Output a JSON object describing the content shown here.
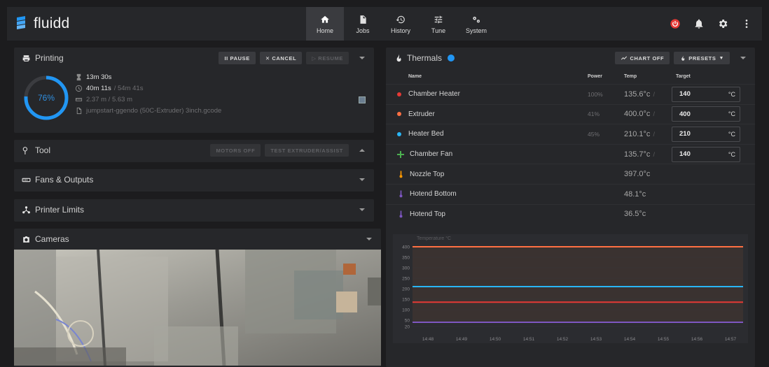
{
  "app": {
    "brand": "fluidd",
    "nav": [
      {
        "label": "Home",
        "icon": "home-icon",
        "active": true
      },
      {
        "label": "Jobs",
        "icon": "file-icon",
        "active": false
      },
      {
        "label": "History",
        "icon": "history-icon",
        "active": false
      },
      {
        "label": "Tune",
        "icon": "tune-icon",
        "active": false
      },
      {
        "label": "System",
        "icon": "gears-icon",
        "active": false
      }
    ],
    "right_icons": [
      "power-icon",
      "bell-icon",
      "settings-icon",
      "more-vert-icon"
    ],
    "accent": "#e53935"
  },
  "printing": {
    "title": "Printing",
    "pause_label": "II PAUSE",
    "cancel_label": "✕ CANCEL",
    "resume_label": "▷ RESUME",
    "progress": 0.76,
    "progress_text": "76%",
    "elapsed": "13m 30s",
    "remaining": "40m 11s",
    "remaining_muted": "/ 54m 41s",
    "filament": "2.37 m / 5.63 m",
    "filename": "jumpstart-ggendo (50C-Extruder) 3inch.gcode"
  },
  "panels": {
    "tool": {
      "title": "Tool",
      "btn1": "MOTORS OFF",
      "btn2": "TEST EXTRUDER/ASSIST"
    },
    "fans": {
      "title": "Fans & Outputs"
    },
    "limits": {
      "title": "Printer Limits"
    },
    "cameras": {
      "title": "Cameras"
    }
  },
  "thermals": {
    "title": "Thermals",
    "chart_off_label": "CHART OFF",
    "presets_label": "PRESETS",
    "headers": {
      "name": "Name",
      "power": "Power",
      "temp": "Temp",
      "target": "Target"
    },
    "rows": [
      {
        "name": "Chamber Heater",
        "color": "#e53935",
        "kind": "dot",
        "power": "100%",
        "temp": "135.6°c",
        "target": "140",
        "unit": "°C"
      },
      {
        "name": "Extruder",
        "color": "#ff7043",
        "kind": "dot",
        "power": "41%",
        "temp": "400.0°c",
        "target": "400",
        "unit": "°C"
      },
      {
        "name": "Heater Bed",
        "color": "#29b6f6",
        "kind": "dot",
        "power": "45%",
        "temp": "210.1°c",
        "target": "210",
        "unit": "°C"
      },
      {
        "name": "Chamber Fan",
        "color": "#4caf50",
        "kind": "fan",
        "power": "",
        "temp": "135.7°c",
        "target": "140",
        "unit": "°C"
      },
      {
        "name": "Nozzle Top",
        "color": "#ff9800",
        "kind": "therm",
        "power": "",
        "temp": "397.0°c",
        "target": "",
        "unit": ""
      },
      {
        "name": "Hotend Bottom",
        "color": "#7e57c2",
        "kind": "therm",
        "power": "",
        "temp": "48.1°c",
        "target": "",
        "unit": ""
      },
      {
        "name": "Hotend Top",
        "color": "#7e57c2",
        "kind": "therm",
        "power": "",
        "temp": "36.5°c",
        "target": "",
        "unit": ""
      }
    ]
  },
  "chart_data": {
    "type": "line",
    "title": "",
    "ylabel": "Temperature °C",
    "xlabel": "",
    "ylim": [
      0,
      420
    ],
    "yticks": [
      400,
      350,
      300,
      250,
      200,
      150,
      100,
      50,
      20
    ],
    "x": [
      "14:48",
      "14:49",
      "14:50",
      "14:51",
      "14:52",
      "14:53",
      "14:54",
      "14:55",
      "14:56",
      "14:57"
    ],
    "series": [
      {
        "color": "#ff7043",
        "values": [
          400,
          400,
          400,
          400,
          400,
          400,
          400,
          400,
          400,
          400
        ]
      },
      {
        "color": "#29b6f6",
        "values": [
          210,
          210,
          210,
          210,
          210,
          210,
          210,
          210,
          210,
          210
        ]
      },
      {
        "color": "#e53935",
        "values": [
          136,
          136,
          136,
          136,
          136,
          136,
          136,
          136,
          136,
          136
        ]
      },
      {
        "color": "#7e57c2",
        "values": [
          40,
          40,
          40,
          40,
          40,
          40,
          40,
          40,
          40,
          40
        ]
      }
    ],
    "grid": true
  }
}
